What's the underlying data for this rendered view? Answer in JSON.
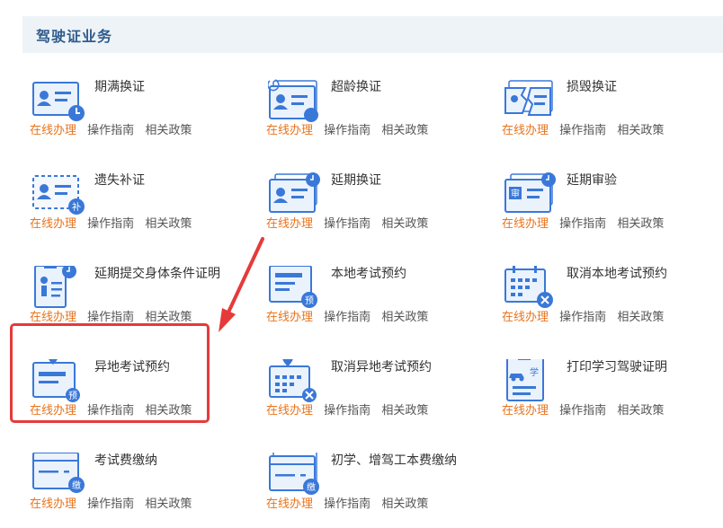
{
  "section_title": "驾驶证业务",
  "link_labels": {
    "online": "在线办理",
    "guide": "操作指南",
    "policy": "相关政策"
  },
  "colors": {
    "accent": "#e8731c",
    "primary_blue": "#3a78d8",
    "header_bg": "#eef3f8",
    "highlight": "#e63a3a"
  },
  "services": [
    {
      "title": "期满换证",
      "icon": "id-card-clock-icon"
    },
    {
      "title": "超龄换证",
      "icon": "id-card-refresh-icon"
    },
    {
      "title": "损毁换证",
      "icon": "id-card-damaged-icon"
    },
    {
      "title": "遗失补证",
      "icon": "id-card-reissue-icon",
      "badge": "补"
    },
    {
      "title": "延期换证",
      "icon": "id-card-stack-clock-icon"
    },
    {
      "title": "延期审验",
      "icon": "review-card-clock-icon",
      "badge": "审"
    },
    {
      "title": "延期提交身体条件证明",
      "icon": "health-certificate-clock-icon"
    },
    {
      "title": "本地考试预约",
      "icon": "exam-booking-icon",
      "badge": "预"
    },
    {
      "title": "取消本地考试预约",
      "icon": "calendar-cancel-icon"
    },
    {
      "title": "异地考试预约",
      "icon": "remote-exam-booking-icon",
      "badge": "预"
    },
    {
      "title": "取消异地考试预约",
      "icon": "remote-calendar-cancel-icon"
    },
    {
      "title": "打印学习驾驶证明",
      "icon": "learner-permit-icon",
      "badge": "学"
    },
    {
      "title": "考试费缴纳",
      "icon": "exam-fee-payment-icon",
      "badge": "缴"
    },
    {
      "title": "初学、增驾工本费缴纳",
      "icon": "license-fee-payment-icon",
      "badge": "缴"
    }
  ]
}
